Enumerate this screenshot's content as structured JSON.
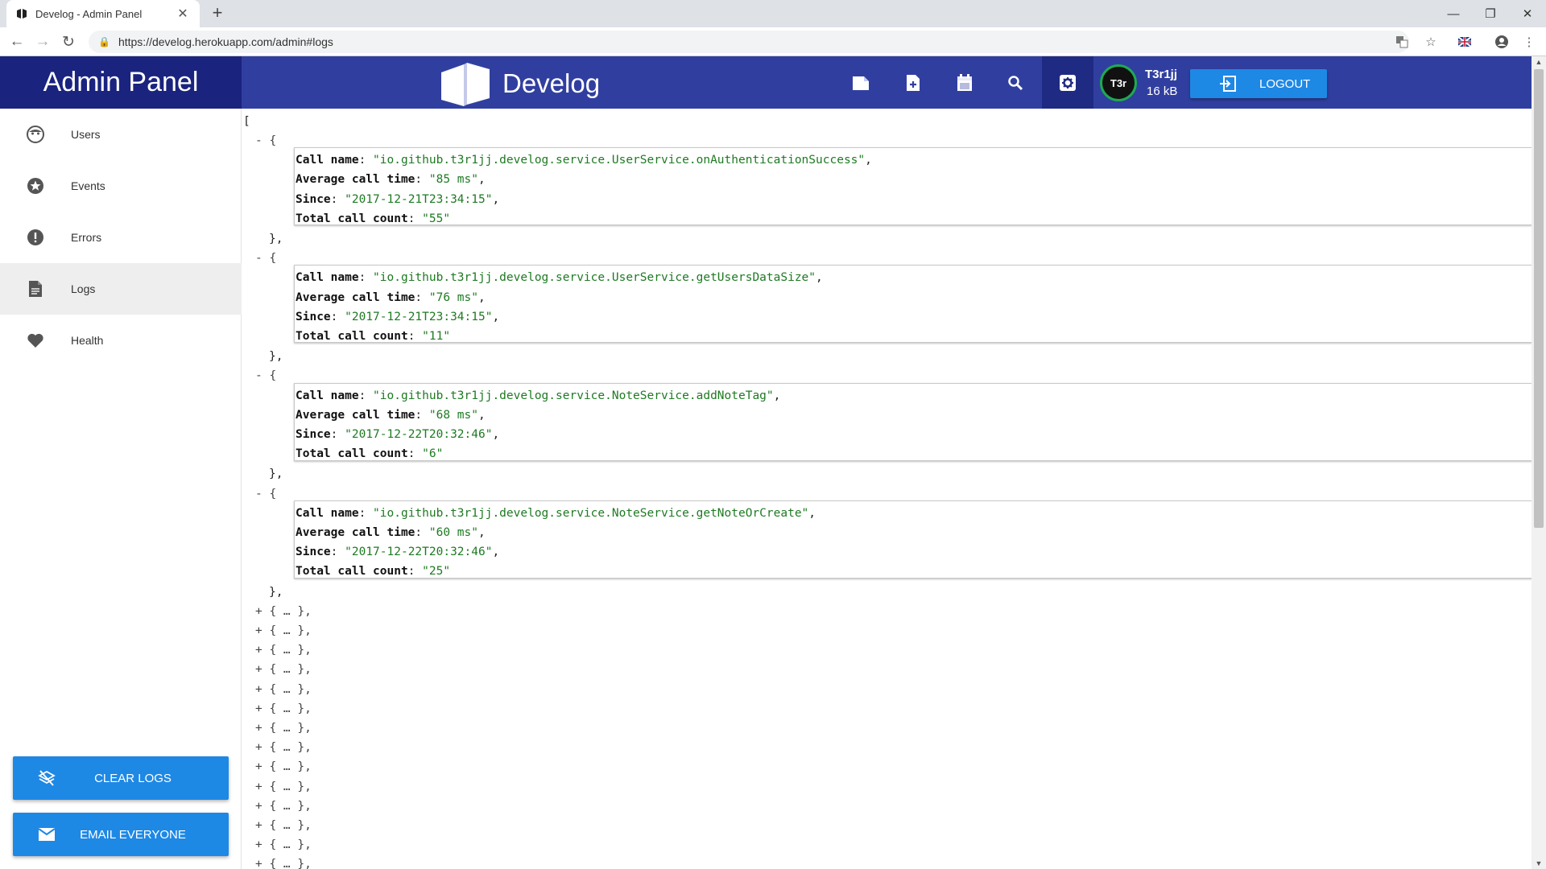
{
  "browser": {
    "tab_title": "Develog - Admin Panel",
    "url": "https://develog.herokuapp.com/admin#logs"
  },
  "header": {
    "admin_title": "Admin Panel",
    "brand_name": "Develog",
    "user_name": "T3r1jj",
    "user_size": "16 kB",
    "avatar_text": "T3r",
    "logout_label": "LOGOUT"
  },
  "sidebar": {
    "items": [
      {
        "label": "Users",
        "icon": "face-icon"
      },
      {
        "label": "Events",
        "icon": "star-icon"
      },
      {
        "label": "Errors",
        "icon": "error-icon"
      },
      {
        "label": "Logs",
        "icon": "document-icon"
      },
      {
        "label": "Health",
        "icon": "heart-icon"
      }
    ],
    "clear_logs_label": "CLEAR LOGS",
    "email_everyone_label": "EMAIL EVERYONE"
  },
  "json_view": {
    "open_bracket": "[",
    "expanded_toggle": "- {",
    "entry_close": "},",
    "collapsed_entry": "+ { … },",
    "keys": {
      "call_name": "Call name",
      "average_call_time": "Average call time",
      "since": "Since",
      "total_call_count": "Total call count"
    },
    "entries": [
      {
        "call_name": "\"io.github.t3r1jj.develog.service.UserService.onAuthenticationSuccess\"",
        "average_call_time": "\"85 ms\"",
        "since": "\"2017-12-21T23:34:15\"",
        "total_call_count": "\"55\""
      },
      {
        "call_name": "\"io.github.t3r1jj.develog.service.UserService.getUsersDataSize\"",
        "average_call_time": "\"76 ms\"",
        "since": "\"2017-12-21T23:34:15\"",
        "total_call_count": "\"11\""
      },
      {
        "call_name": "\"io.github.t3r1jj.develog.service.NoteService.addNoteTag\"",
        "average_call_time": "\"68 ms\"",
        "since": "\"2017-12-22T20:32:46\"",
        "total_call_count": "\"6\""
      },
      {
        "call_name": "\"io.github.t3r1jj.develog.service.NoteService.getNoteOrCreate\"",
        "average_call_time": "\"60 ms\"",
        "since": "\"2017-12-22T20:32:46\"",
        "total_call_count": "\"25\""
      }
    ],
    "collapsed_count": 14
  },
  "colors": {
    "header_bg": "#303f9f",
    "admin_title_bg": "#1a237e",
    "button_blue": "#1e88e5",
    "json_string": "#1e7a22"
  }
}
